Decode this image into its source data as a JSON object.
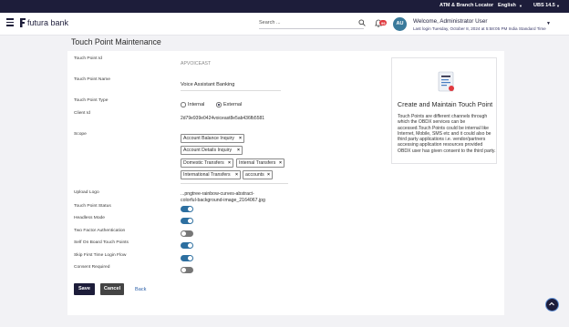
{
  "topbar": {
    "atm_locator": "ATM & Branch Locator",
    "language": "English",
    "version": "UBS 14.5"
  },
  "header": {
    "brand": "futura bank",
    "search_placeholder": "Search ...",
    "notification_count": "99",
    "avatar_initials": "AU",
    "welcome": "Welcome, Administrator User",
    "last_login": "Last login Tuesday, October 8, 2024 at 5:58:05 PM India Standard Time"
  },
  "page": {
    "title": "Touch Point Maintenance"
  },
  "form": {
    "touch_point_id": {
      "label": "Touch Point Id",
      "value": "APVOICEAST"
    },
    "touch_point_name": {
      "label": "Touch Point Name",
      "value": "Voice Assistant Banking"
    },
    "touch_point_type": {
      "label": "Touch Point Type",
      "options": [
        "Internal",
        "External"
      ],
      "selected": "External"
    },
    "client_id": {
      "label": "Client Id",
      "value": "2d79e939e0424voiceast8e5ab436fb5581"
    },
    "scope": {
      "label": "Scope",
      "chips": [
        "Account Balance Inquiry",
        "Account Details Inquiry",
        "Domestic Transfers",
        "Internal Transfers",
        "International Transfers",
        "accounts"
      ]
    },
    "upload_logo": {
      "label": "Upload Logo",
      "value_line1": "...pngtree-rainbow-curves-abstract-",
      "value_line2": "colorful-background-image_2164067.jpg"
    },
    "toggles": [
      {
        "label": "Touch Point Status",
        "on": true
      },
      {
        "label": "Headless Mode",
        "on": true
      },
      {
        "label": "Two Factor Authentication",
        "on": false
      },
      {
        "label": "Self On Board Touch Points",
        "on": true
      },
      {
        "label": "Skip First Time Login Flow",
        "on": true
      },
      {
        "label": "Consent Required",
        "on": false
      }
    ]
  },
  "actions": {
    "save": "Save",
    "cancel": "Cancel",
    "back": "Back"
  },
  "info_panel": {
    "title": "Create and Maintain Touch Point",
    "description": "Touch Points are different channels through which the OBDX services can be accessed.Touch Points could be internal like Internet, Mobile, SMS etc and it could also be third party applications i.e. vendor/partners accessing application resources provided OBDX user has given consent to the third party."
  },
  "colors": {
    "primary": "#1d1d3a",
    "accent": "#2d6fa0",
    "link": "#2b5fa8",
    "background": "#f2f2f5"
  }
}
